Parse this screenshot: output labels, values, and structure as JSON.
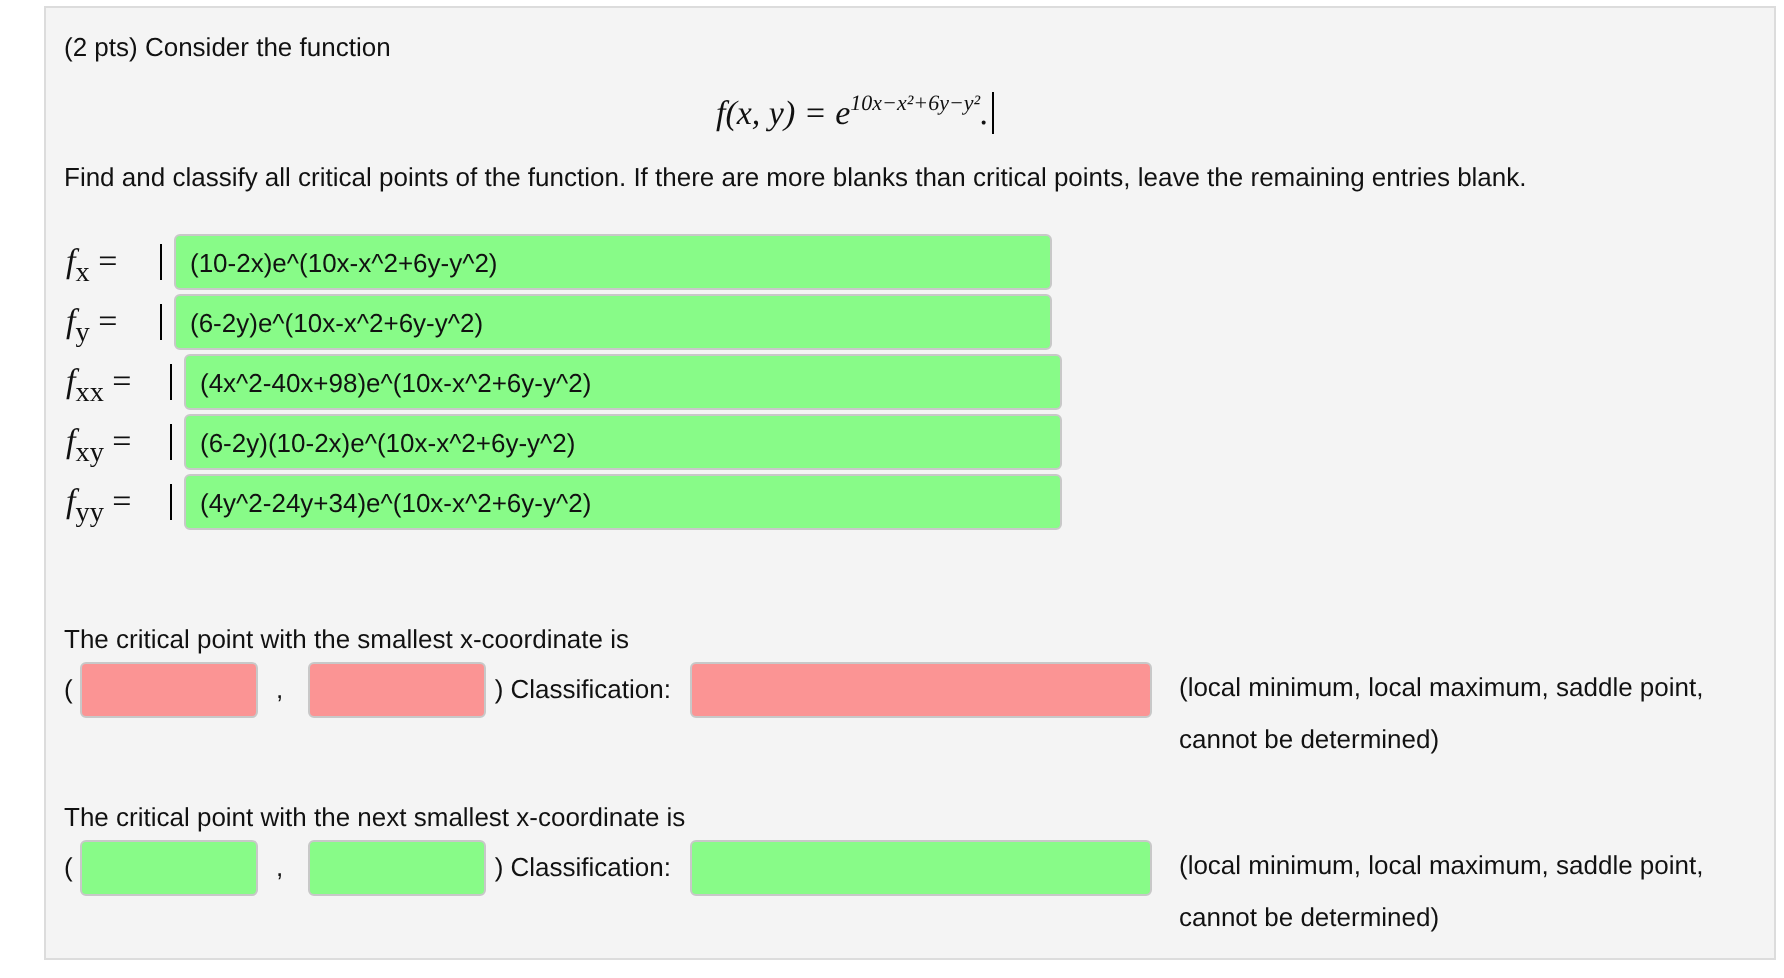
{
  "header": "(2 pts) Consider the function",
  "formula": {
    "base": "f(x, y) = e",
    "exponent": "10x−x²+6y−y²",
    "end": "."
  },
  "instructions": "Find and classify all critical points of the function. If there are more blanks than critical points, leave the remaining entries blank.",
  "derivatives": [
    {
      "label": "*f*$_{x}$ =",
      "value": "(10-2x)e^(10x-x^2+6y-y^2)",
      "correct": true
    },
    {
      "label": "*f*$_{y}$ =",
      "value": "(6-2y)e^(10x-x^2+6y-y^2)",
      "correct": true
    },
    {
      "label": "*f*$_{xx}$ =",
      "value": "(4x^2-40x+98)e^(10x-x^2+6y-y^2)",
      "correct": true
    },
    {
      "label": "*f*$_{xy}$ =",
      "value": "(6-2y)(10-2x)e^(10x-x^2+6y-y^2)",
      "correct": true
    },
    {
      "label": "*f*$_{yy}$ =",
      "value": "(4y^2-24y+34)e^(10x-x^2+6y-y^2)",
      "correct": true
    }
  ],
  "points": [
    {
      "prompt": "The critical point with the smallest x-coordinate is",
      "open": "(",
      "comma": ",",
      "close": ") Classification:",
      "x_correct": false,
      "y_correct": false,
      "class_correct": false,
      "options": "(local minimum, local maximum, saddle point, cannot be determined)"
    },
    {
      "prompt": "The critical point with the next smallest x-coordinate is",
      "open": "(",
      "comma": ",",
      "close": ") Classification:",
      "x_correct": true,
      "y_correct": true,
      "class_correct": true,
      "options": "(local minimum, local maximum, saddle point, cannot be determined)"
    }
  ]
}
